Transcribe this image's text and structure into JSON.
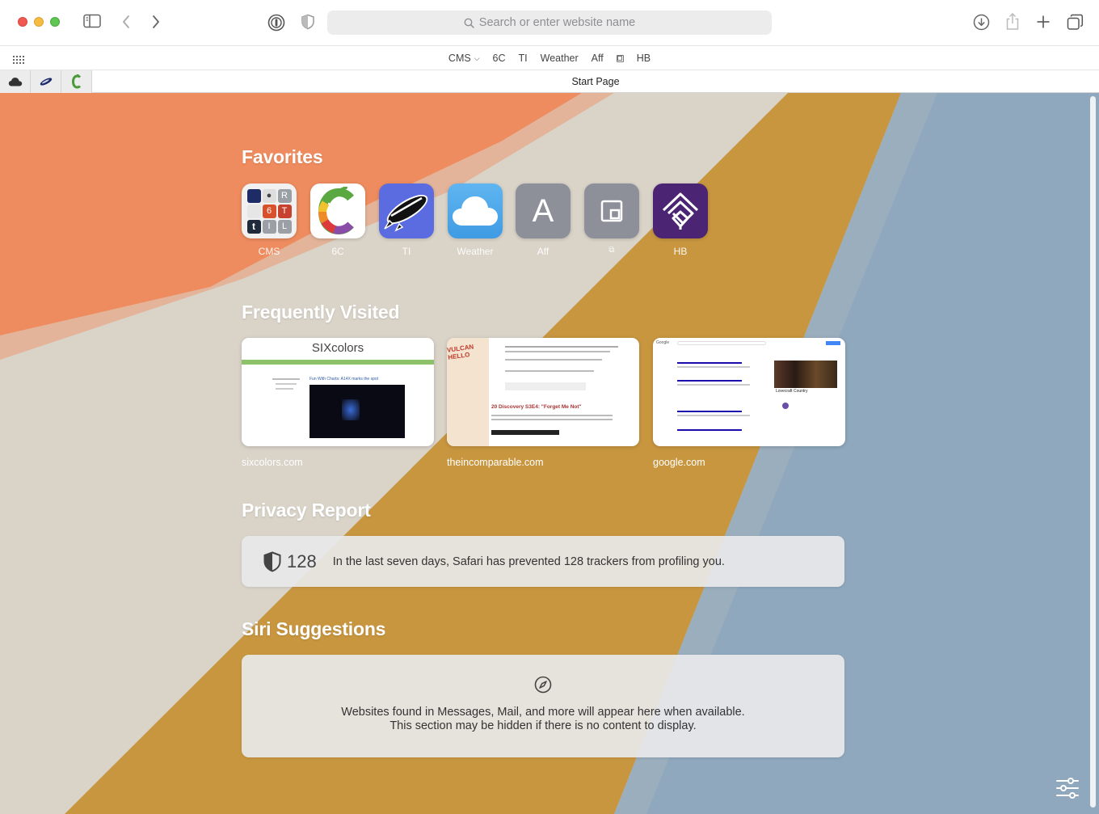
{
  "toolbar": {
    "search_placeholder": "Search or enter website name"
  },
  "bookmarks_bar": {
    "items": [
      {
        "label": "CMS",
        "has_menu": true
      },
      {
        "label": "6C"
      },
      {
        "label": "TI"
      },
      {
        "label": "Weather"
      },
      {
        "label": "Aff"
      },
      {
        "label": "",
        "icon": "window-icon"
      },
      {
        "label": "HB"
      }
    ]
  },
  "tabs": {
    "pinned": [
      {
        "icon": "cloud-icon"
      },
      {
        "icon": "blimp-icon"
      },
      {
        "icon": "6c-logo-icon"
      }
    ],
    "active_title": "Start Page"
  },
  "start_page": {
    "favorites_title": "Favorites",
    "favorites": [
      {
        "label": "CMS",
        "icon": "cms-folder-icon"
      },
      {
        "label": "6C",
        "icon": "sixcolors-icon"
      },
      {
        "label": "TI",
        "icon": "blimp-icon"
      },
      {
        "label": "Weather",
        "icon": "cloud-icon"
      },
      {
        "label": "Aff",
        "icon": "letter-a-icon",
        "letter": "A"
      },
      {
        "label": "⧉",
        "icon": "window-icon"
      },
      {
        "label": "HB",
        "icon": "house-icon"
      }
    ],
    "cms_grid_letters": [
      "",
      "",
      "R",
      "",
      "6",
      "T",
      "t",
      "I",
      "L"
    ],
    "frequently_visited_title": "Frequently Visited",
    "frequently_visited": [
      {
        "label": "sixcolors.com",
        "thumb_title": "SIXcolors",
        "thumb_headline": "Fun With Charts: A14X marks the spot"
      },
      {
        "label": "theincomparable.com",
        "thumb_title": "VULCAN HELLO",
        "thumb_headline": "20 Discovery S3E4: \"Forget Me Not\""
      },
      {
        "label": "google.com",
        "thumb_title": "Google",
        "thumb_headline": "Lovecraft Country"
      }
    ],
    "privacy_report_title": "Privacy Report",
    "privacy_report": {
      "count": "128",
      "message": "In the last seven days, Safari has prevented 128 trackers from profiling you."
    },
    "siri_suggestions_title": "Siri Suggestions",
    "siri_suggestions": {
      "line1": "Websites found in Messages, Mail, and more will appear here when available.",
      "line2": "This section may be hidden if there is no content to display."
    }
  },
  "colors": {
    "wallpaper_orange": "#ef9064",
    "wallpaper_cream": "#d8d2c7",
    "wallpaper_gold": "#c9973f",
    "wallpaper_blue": "#8fa7bc",
    "weather_blue": "#4fa9ea",
    "ti_purple": "#5a6ce0",
    "hb_purple": "#4b2474"
  }
}
